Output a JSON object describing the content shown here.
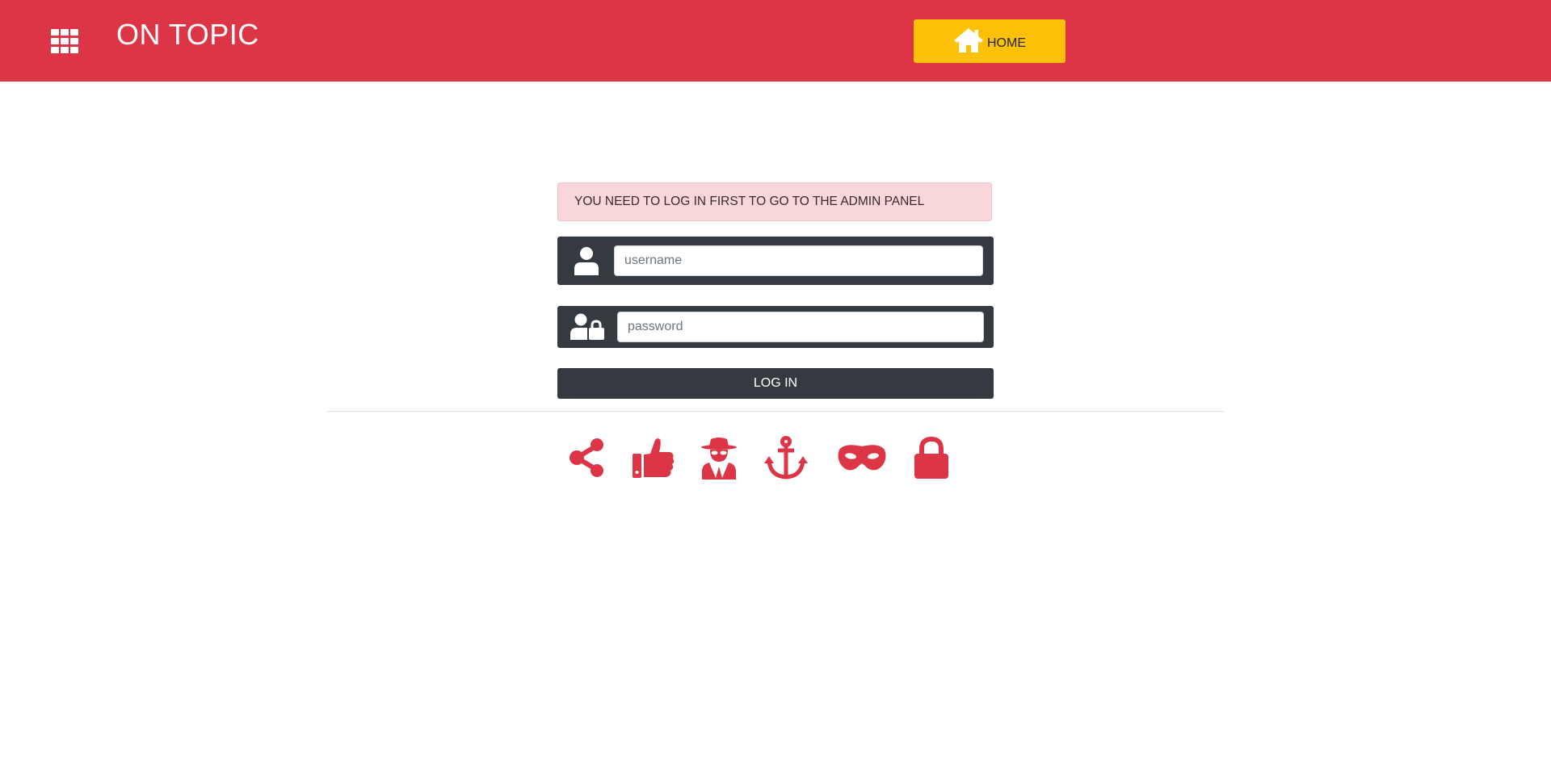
{
  "header": {
    "brand": "ON TOPIC",
    "home_label": "HOME",
    "colors": {
      "bar": "#dc3545",
      "home_button": "#ffc107"
    },
    "icons": {
      "menu": "grid-icon",
      "home": "home-icon"
    }
  },
  "login": {
    "alert_text": "YOU NEED TO LOG IN FIRST TO GO TO THE ADMIN PANEL",
    "username": {
      "placeholder": "username",
      "value": "",
      "icon": "user-icon"
    },
    "password": {
      "placeholder": "password",
      "value": "",
      "icon": "user-lock-icon"
    },
    "submit_label": "LOG IN"
  },
  "footer": {
    "icons": [
      "share-icon",
      "thumbs-up-icon",
      "spy-icon",
      "anchor-icon",
      "mask-icon",
      "lock-icon"
    ],
    "icon_color": "#dc3545"
  }
}
